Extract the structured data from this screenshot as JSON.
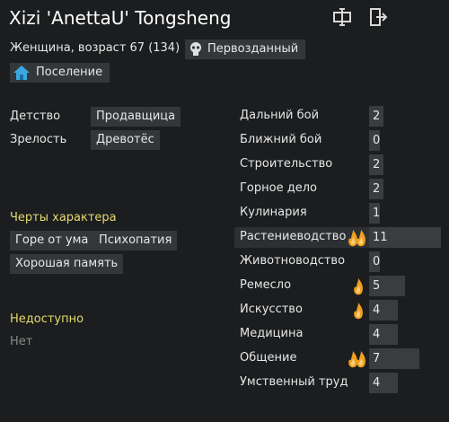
{
  "header": {
    "name": "Xizi 'AnettaU' Tongsheng",
    "subline": "Женщина, возраст 67 (134)",
    "faction": "Первозданный",
    "settlement": "Поселение"
  },
  "backstory": {
    "childhood_label": "Детство",
    "childhood_value": "Продавщица",
    "adulthood_label": "Зрелость",
    "adulthood_value": "Древотёс"
  },
  "traits": {
    "heading": "Черты характера",
    "items": [
      "Горе от ума",
      "Психопатия",
      "Хорошая память"
    ]
  },
  "incapable": {
    "heading": "Недоступно",
    "value": "Нет"
  },
  "skills": [
    {
      "name": "Дальний бой",
      "level": 2,
      "passion": "none"
    },
    {
      "name": "Ближний бой",
      "level": 0,
      "passion": "none"
    },
    {
      "name": "Строительство",
      "level": 2,
      "passion": "none"
    },
    {
      "name": "Горное дело",
      "level": 2,
      "passion": "none"
    },
    {
      "name": "Кулинария",
      "level": 1,
      "passion": "none"
    },
    {
      "name": "Растениеводство",
      "level": 11,
      "passion": "major"
    },
    {
      "name": "Животноводство",
      "level": 0,
      "passion": "none"
    },
    {
      "name": "Ремесло",
      "level": 5,
      "passion": "minor"
    },
    {
      "name": "Искусство",
      "level": 4,
      "passion": "minor"
    },
    {
      "name": "Медицина",
      "level": 4,
      "passion": "none"
    },
    {
      "name": "Общение",
      "level": 7,
      "passion": "major"
    },
    {
      "name": "Умственный труд",
      "level": 4,
      "passion": "none"
    }
  ],
  "skill_max": 20,
  "colors": {
    "background": "#1b1d1f",
    "chip": "#34373a",
    "heading_yellow": "#e6d96e",
    "flame": "#f0a020"
  },
  "icons": {
    "rename": "rename-icon",
    "exit": "exit-icon",
    "faction": "skull-icon",
    "settlement": "home-icon",
    "passion": "flame-icon"
  }
}
